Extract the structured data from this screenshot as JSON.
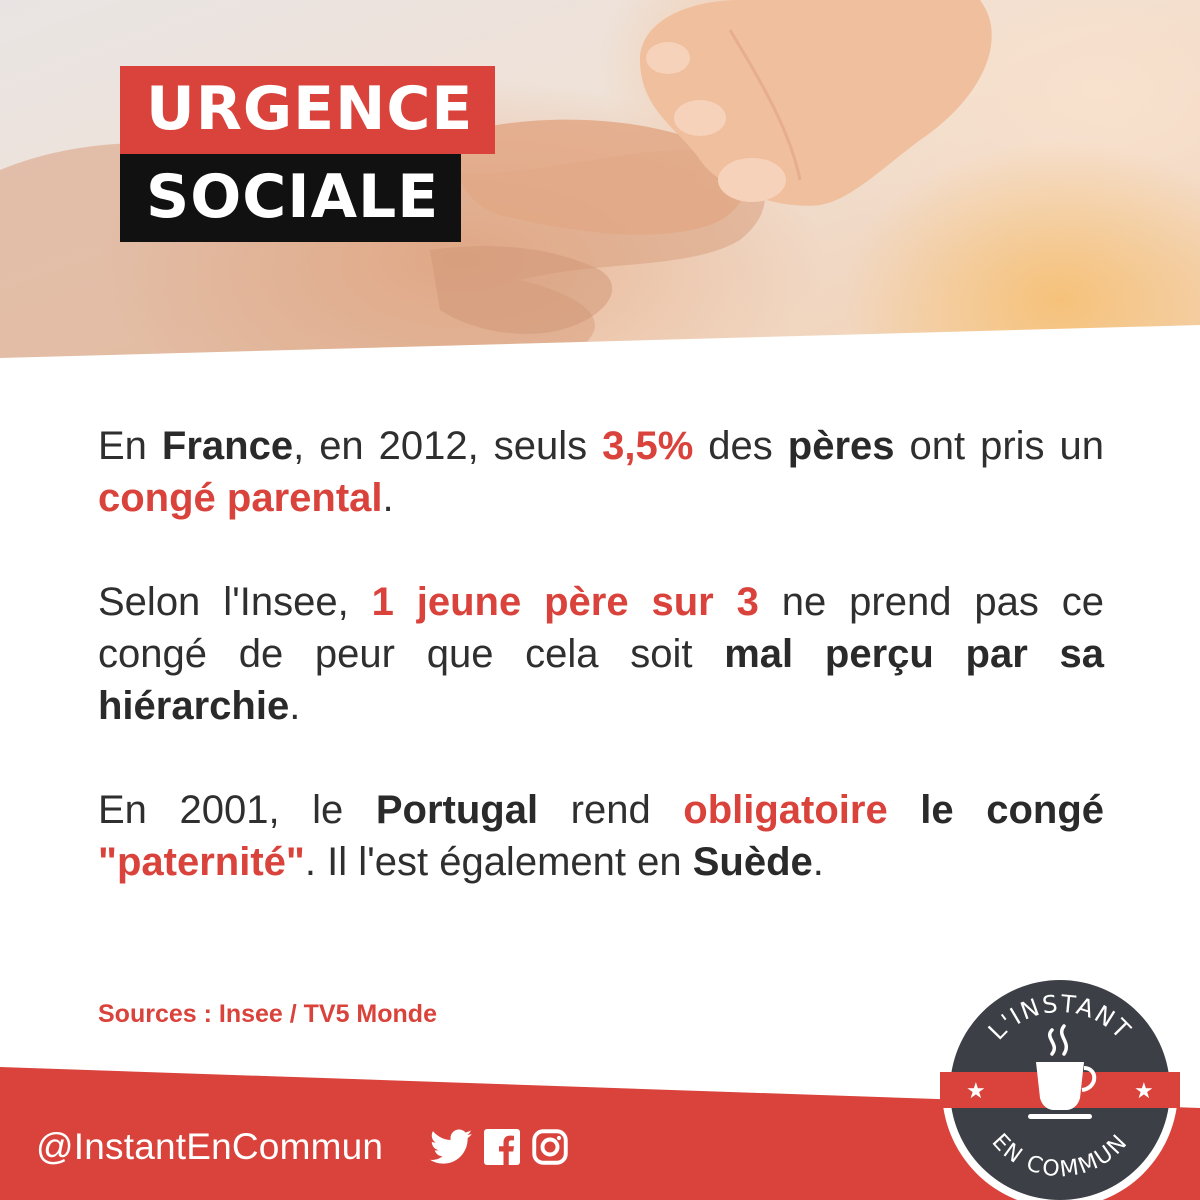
{
  "headline": {
    "line1": "URGENCE",
    "line2": "SOCIALE"
  },
  "paragraphs": {
    "p1": {
      "t1": "En ",
      "b1": "France",
      "t2": ", en 2012, seuls ",
      "r1": "3,5%",
      "t3": " des ",
      "b2": "pères",
      "t4": " ont pris un ",
      "r2": "congé parental",
      "t5": "."
    },
    "p2": {
      "t1": "Selon l'Insee, ",
      "r1": "1 jeune père sur 3",
      "t2": " ne prend pas ce congé de peur que cela soit ",
      "b1": "mal perçu par sa hiérarchie",
      "t3": "."
    },
    "p3": {
      "t1": "En 2001, le ",
      "b1": "Portugal",
      "t2": " rend ",
      "r1": "obligatoire",
      "t3": " ",
      "b2": "le congé",
      "t4": " ",
      "r2": "\"paternité\"",
      "t5": ". Il l'est également en ",
      "b3": "Suède",
      "t6": "."
    }
  },
  "sources": "Sources : Insee / TV5 Monde",
  "footer": {
    "handle": "@InstantEnCommun",
    "icons": [
      "twitter-icon",
      "facebook-icon",
      "instagram-icon"
    ]
  },
  "logo": {
    "top_text": "L'INSTANT",
    "bottom_text": "EN COMMUN",
    "icon": "coffee-cup-icon"
  },
  "colors": {
    "accent": "#d9433b",
    "dark": "#111111",
    "badge": "#3c3f45",
    "text": "#2f2f2f"
  }
}
